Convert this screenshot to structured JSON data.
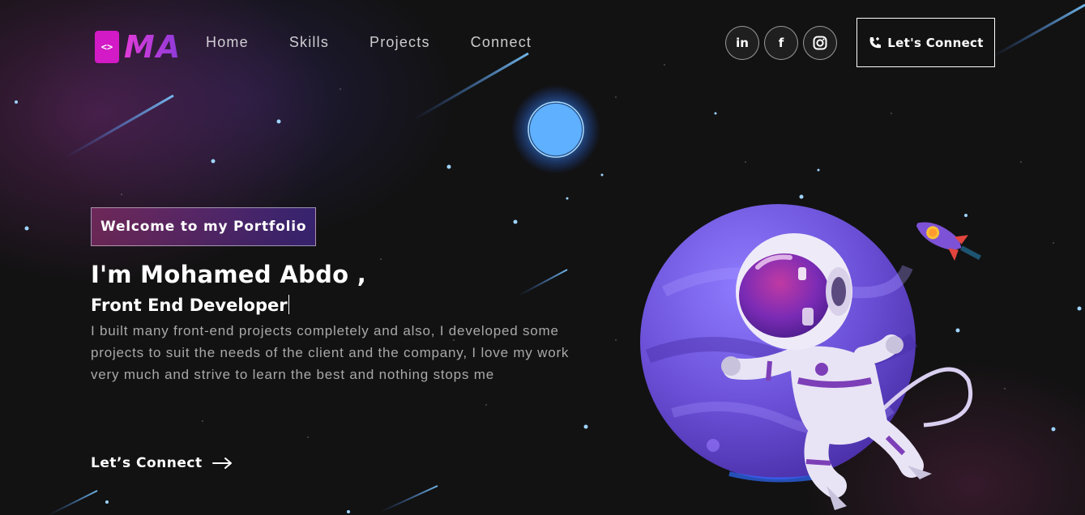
{
  "brand": {
    "logo_icon": "<>",
    "logo_text": "MA"
  },
  "nav": {
    "links": [
      "Home",
      "Skills",
      "Projects",
      "Connect"
    ],
    "social": [
      {
        "icon": "linkedin-icon",
        "glyph": "in"
      },
      {
        "icon": "facebook-icon",
        "glyph": "f"
      },
      {
        "icon": "instagram-icon",
        "glyph": ""
      }
    ],
    "cta_label": "Let's Connect"
  },
  "hero": {
    "tagline": "Welcome to my Portfolio",
    "name": "I'm Mohamed Abdo ,",
    "role": "Front End Developer",
    "description": "I built many front-end projects completely and also, I developed some projects to suit the needs of the client and the company, I love my work very much and strive to learn the best and nothing stops me",
    "link_label": "Let’s Connect"
  },
  "colors": {
    "background": "#121212",
    "accent_pink": "#d21ac6",
    "accent_purple": "#8a3bd9",
    "planet": "#6a4fd6"
  }
}
